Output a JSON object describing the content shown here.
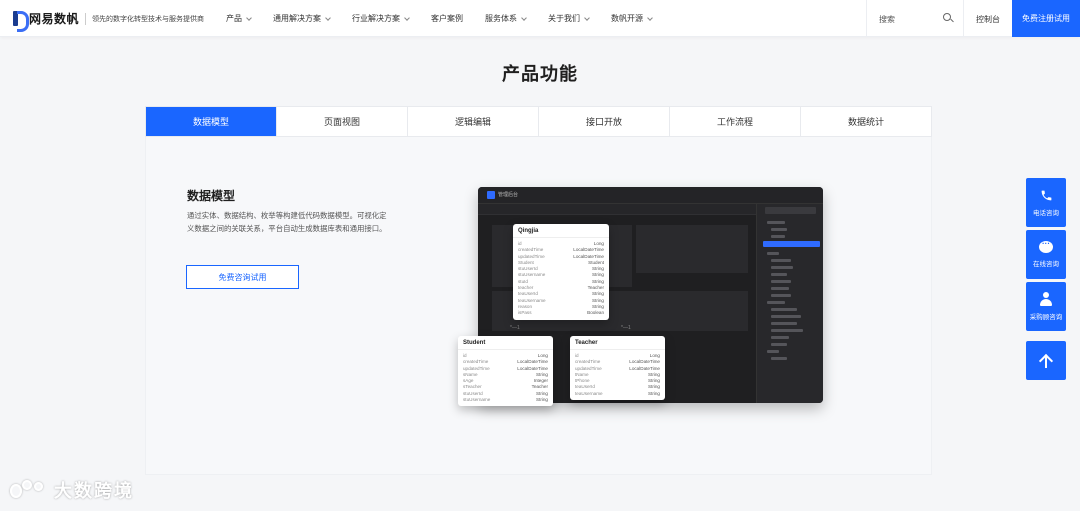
{
  "nav": {
    "logo_text": "网易数帆",
    "slogan": "领先的数字化转型技术与服务提供商",
    "menu": [
      {
        "label": "产品",
        "dropdown": true
      },
      {
        "label": "通用解决方案",
        "dropdown": true
      },
      {
        "label": "行业解决方案",
        "dropdown": true
      },
      {
        "label": "客户案例",
        "dropdown": false
      },
      {
        "label": "服务体系",
        "dropdown": true
      },
      {
        "label": "关于我们",
        "dropdown": true
      },
      {
        "label": "数帆开源",
        "dropdown": true
      }
    ],
    "search_label": "搜索",
    "console_label": "控制台",
    "register_label": "免费注册试用"
  },
  "section_title": "产品功能",
  "tabs": [
    {
      "label": "数据模型",
      "active": true
    },
    {
      "label": "页面视图",
      "active": false
    },
    {
      "label": "逻辑编辑",
      "active": false
    },
    {
      "label": "接口开放",
      "active": false
    },
    {
      "label": "工作流程",
      "active": false
    },
    {
      "label": "数据统计",
      "active": false
    }
  ],
  "panel": {
    "title": "数据模型",
    "description": "通过实体、数据结构、枚举等构建低代码数据模型。可视化定义数据之间的关联关系，平台自动生成数据库表和通用接口。",
    "button_label": "免费咨询试用"
  },
  "screenshot": {
    "app_name": "管理后台",
    "relation_left": "*—1",
    "relation_right": "*—1",
    "entities": {
      "qingjia": {
        "name": "Qingjia",
        "fields": [
          {
            "k": "id",
            "v": "Long"
          },
          {
            "k": "createdTime",
            "v": "LocalDateTime"
          },
          {
            "k": "updatedTime",
            "v": "LocalDateTime"
          },
          {
            "k": "Student",
            "v": "Student"
          },
          {
            "k": "stuUserId",
            "v": "String"
          },
          {
            "k": "stuUsername",
            "v": "String"
          },
          {
            "k": "stuId",
            "v": "String"
          },
          {
            "k": "teacher",
            "v": "Teacher"
          },
          {
            "k": "teaUserId",
            "v": "String"
          },
          {
            "k": "teaUsername",
            "v": "String"
          },
          {
            "k": "reason",
            "v": "String"
          },
          {
            "k": "isPass",
            "v": "Boolean"
          }
        ]
      },
      "student": {
        "name": "Student",
        "fields": [
          {
            "k": "id",
            "v": "Long"
          },
          {
            "k": "createdTime",
            "v": "LocalDateTime"
          },
          {
            "k": "updatedTime",
            "v": "LocalDateTime"
          },
          {
            "k": "sName",
            "v": "String"
          },
          {
            "k": "sAge",
            "v": "Integer"
          },
          {
            "k": "sTeacher",
            "v": "Teacher"
          },
          {
            "k": "stuUserId",
            "v": "String"
          },
          {
            "k": "stuUsername",
            "v": "String"
          }
        ]
      },
      "teacher": {
        "name": "Teacher",
        "fields": [
          {
            "k": "id",
            "v": "Long"
          },
          {
            "k": "createdTime",
            "v": "LocalDateTime"
          },
          {
            "k": "updatedTime",
            "v": "LocalDateTime"
          },
          {
            "k": "tName",
            "v": "String"
          },
          {
            "k": "tPhone",
            "v": "String"
          },
          {
            "k": "teaUserId",
            "v": "String"
          },
          {
            "k": "teaUsername",
            "v": "String"
          }
        ]
      }
    }
  },
  "side_buttons": [
    {
      "label": "电话咨询",
      "icon": "phone-icon"
    },
    {
      "label": "在线咨询",
      "icon": "chat-icon"
    },
    {
      "label": "采购顾咨询",
      "icon": "consultant-icon"
    },
    {
      "label": "",
      "icon": "arrow-up-icon"
    }
  ],
  "watermark": "大数跨境"
}
